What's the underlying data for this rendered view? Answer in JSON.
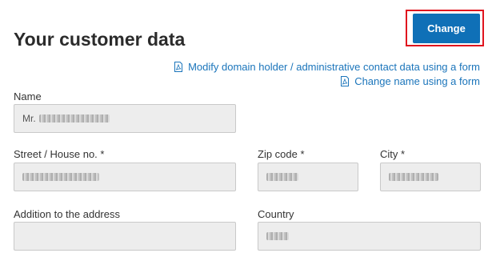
{
  "header": {
    "title": "Your customer data",
    "change_button_label": "Change"
  },
  "links": {
    "modify_domain_holder": "Modify domain holder / administrative contact data using a form",
    "change_name": "Change name using a form"
  },
  "form": {
    "name": {
      "label": "Name",
      "value_prefix": "Mr."
    },
    "street": {
      "label": "Street / House no. *"
    },
    "zip": {
      "label": "Zip code *"
    },
    "city": {
      "label": "City *"
    },
    "addition": {
      "label": "Addition to the address"
    },
    "country": {
      "label": "Country"
    }
  },
  "colors": {
    "primary_button": "#0f70b7",
    "link": "#1b75bb",
    "highlight_border": "#e0141e",
    "field_background": "#ededed"
  },
  "icons": {
    "document": "pdf-document-icon"
  }
}
